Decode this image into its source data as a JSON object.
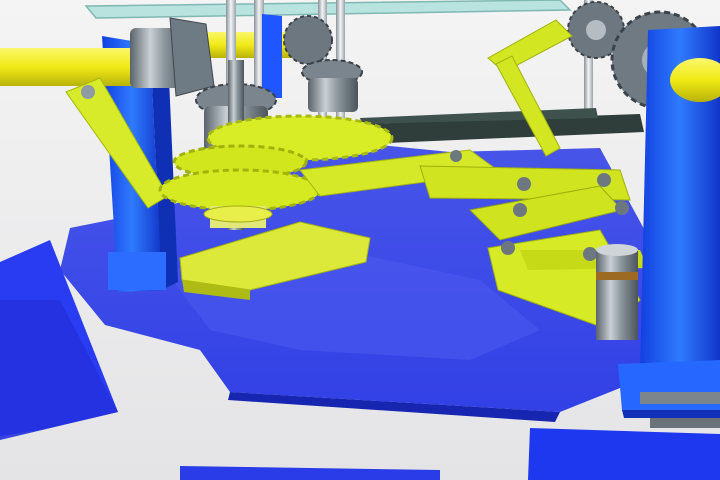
{
  "scene": {
    "subject": "gear-and-linkage-mechanism-render",
    "colors": {
      "background": "#ececec",
      "platform_blue": "#2b3cf0",
      "frame_blue": "#1e5cff",
      "linkage_yellow": "#d8ec1e",
      "shaft_yellow": "#f2ee1a",
      "gear_steel": "#7c8891",
      "belt_dark": "#2e3e3a"
    }
  }
}
